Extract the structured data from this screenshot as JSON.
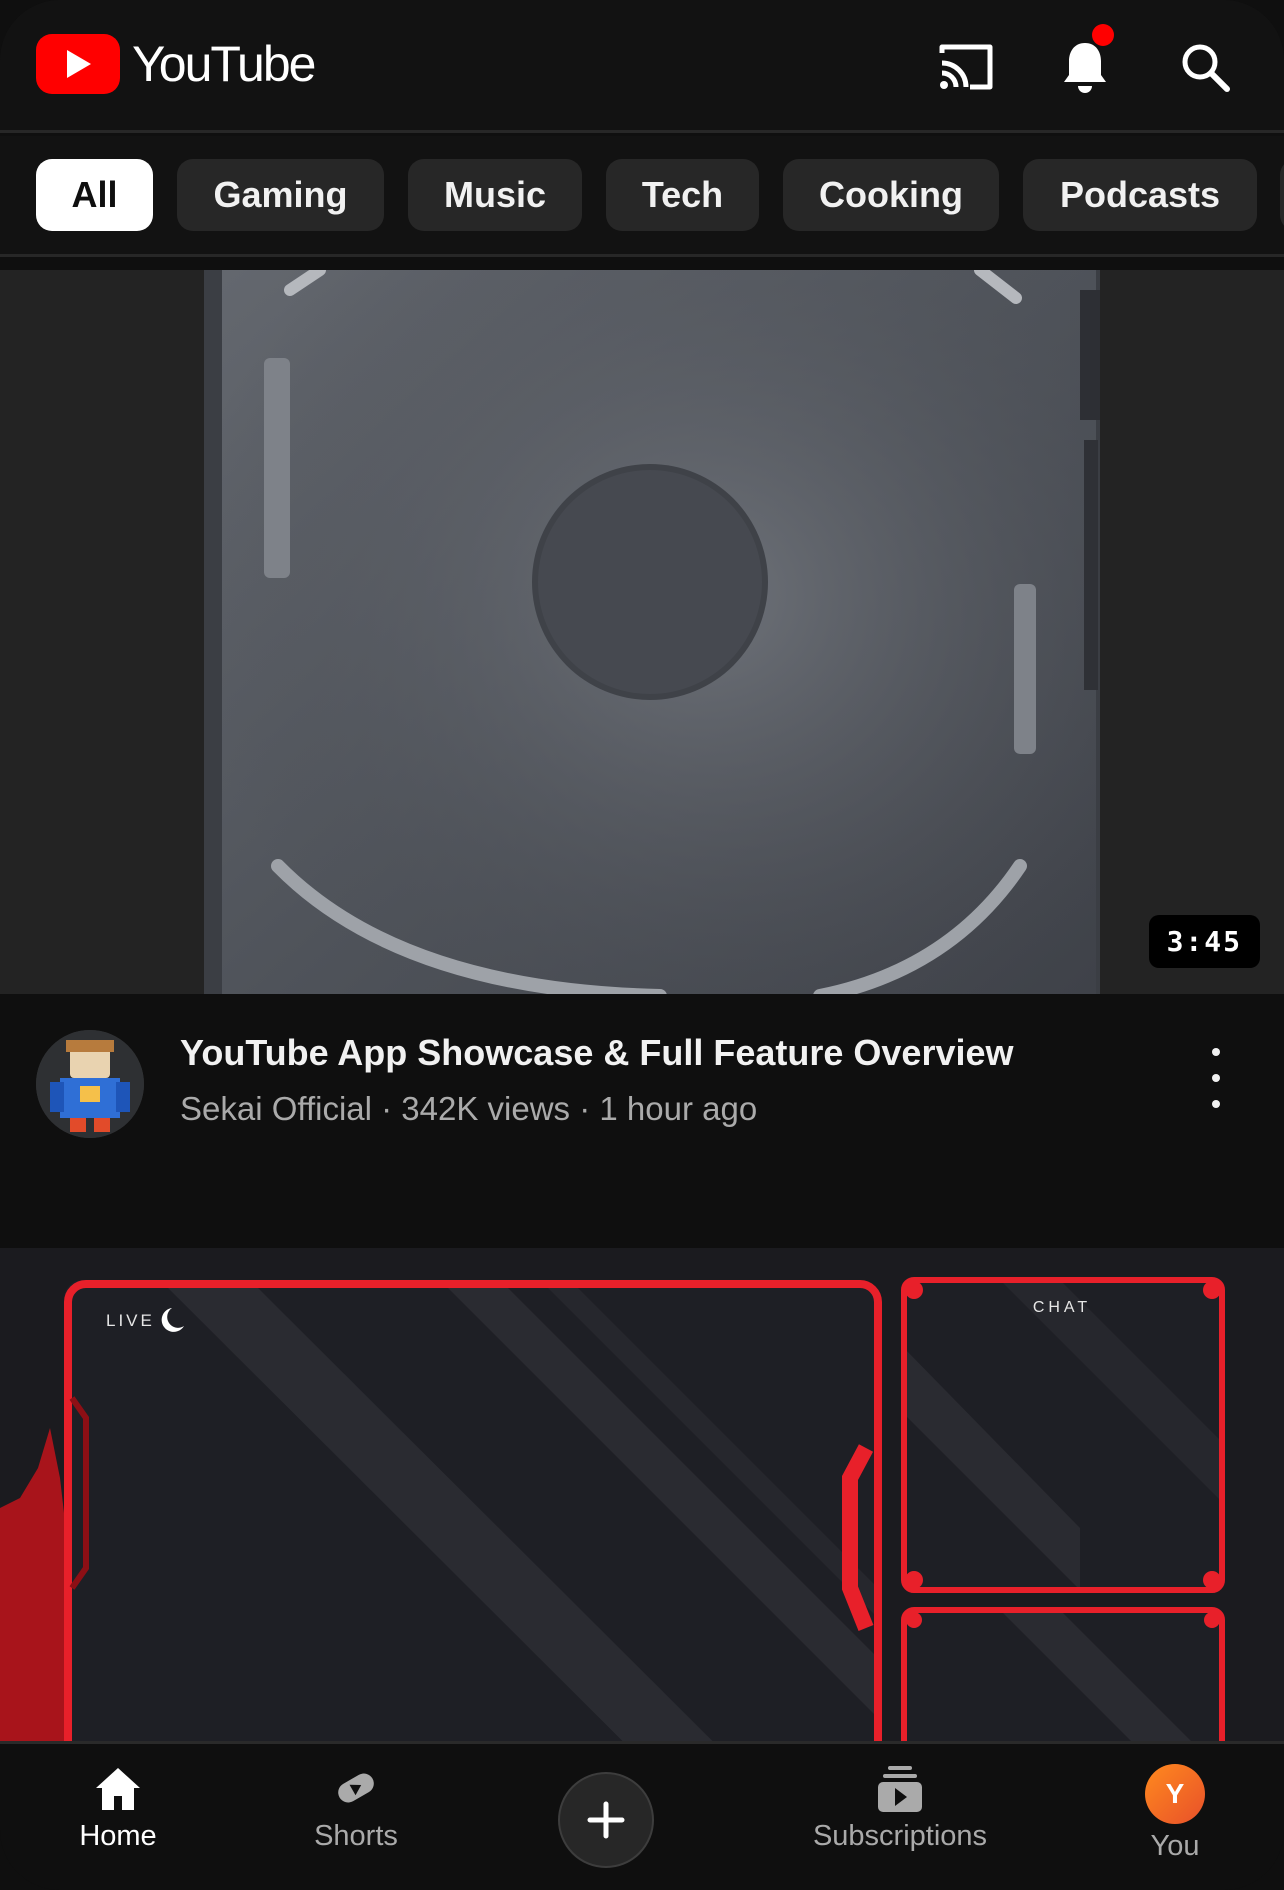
{
  "header": {
    "logo_text": "YouTube",
    "icons": [
      "cast-icon",
      "notifications-bell-icon",
      "search-icon"
    ],
    "has_notification_dot": true
  },
  "chips": [
    {
      "label": "All",
      "active": true
    },
    {
      "label": "Gaming",
      "active": false
    },
    {
      "label": "Music",
      "active": false
    },
    {
      "label": "Tech",
      "active": false
    },
    {
      "label": "Cooking",
      "active": false
    },
    {
      "label": "Podcasts",
      "active": false
    }
  ],
  "feed": {
    "video1": {
      "duration": "3:45",
      "title": "YouTube App Showcase & Full Feature Overview",
      "channel": "Sekai Official",
      "views": "342K views",
      "age": "1 hour ago",
      "subtitle": "Sekai Official · 342K views · 1 hour ago"
    },
    "video2": {
      "overlay_live": "LIVE",
      "overlay_chat": "CHAT"
    }
  },
  "bottom_nav": {
    "home": "Home",
    "shorts": "Shorts",
    "subscriptions": "Subscriptions",
    "you": "You",
    "you_initial": "Y"
  },
  "colors": {
    "brand_red": "#ff0000",
    "background": "#0f0f0f",
    "chip_bg": "#272727",
    "secondary_text": "#aaaaaa",
    "overlay_red": "#e8202a"
  }
}
